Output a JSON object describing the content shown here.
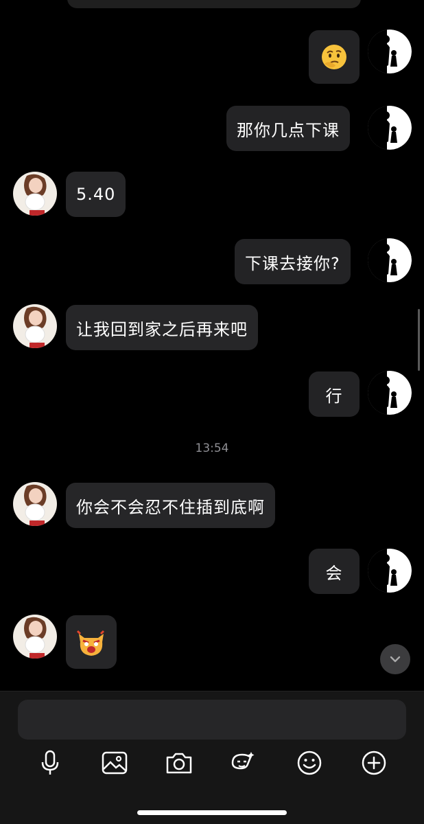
{
  "messages": [
    {
      "from": "me",
      "type": "emoji",
      "icon": "thinking-face-emoji"
    },
    {
      "from": "me",
      "text": "那你几点下课"
    },
    {
      "from": "them",
      "text": "5.40"
    },
    {
      "from": "me",
      "text": "下课去接你?"
    },
    {
      "from": "them",
      "text": "让我回到家之后再来吧"
    },
    {
      "from": "me",
      "text": "行"
    },
    {
      "from": "them",
      "text": "你会不会忍不住插到底啊"
    },
    {
      "from": "me",
      "text": "会"
    },
    {
      "from": "them",
      "type": "emoji",
      "icon": "angry-cat-emoji"
    }
  ],
  "timestamp": "13:54",
  "composer": {
    "placeholder": ""
  },
  "toolbar": [
    "microphone-icon",
    "image-icon",
    "camera-icon",
    "sticker-icon",
    "emoji-icon",
    "plus-icon"
  ],
  "colors": {
    "background": "#000000",
    "bubble": "#262628",
    "timestamp": "#8e8e93"
  }
}
